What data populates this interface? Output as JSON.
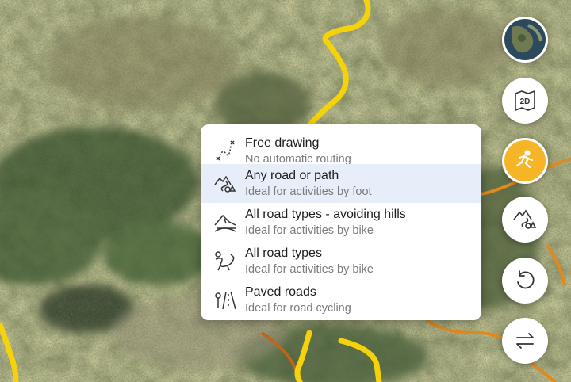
{
  "routing_menu": {
    "items": [
      {
        "title": "Free drawing",
        "subtitle": "No automatic routing",
        "icon": "free-drawing-icon"
      },
      {
        "title": "Any road or path",
        "subtitle": "Ideal for activities by foot",
        "icon": "any-road-icon",
        "selected": true
      },
      {
        "title": "All road types - avoiding hills",
        "subtitle": "Ideal for activities by bike",
        "icon": "avoid-hills-icon"
      },
      {
        "title": "All road types",
        "subtitle": "Ideal for activities by bike",
        "icon": "all-roads-icon"
      },
      {
        "title": "Paved roads",
        "subtitle": "Ideal for road cycling",
        "icon": "paved-road-icon"
      }
    ]
  },
  "side_controls": {
    "view_toggle_label": "2D",
    "buttons": [
      "map-layer-thumbnail",
      "2d-view-icon",
      "running-icon",
      "route-type-icon",
      "undo-icon",
      "swap-icon"
    ]
  },
  "colors": {
    "accent": "#f6b526",
    "route": "#f5d20a",
    "secondary_route": "#e08a1e",
    "selected_row": "#e8eef9"
  }
}
